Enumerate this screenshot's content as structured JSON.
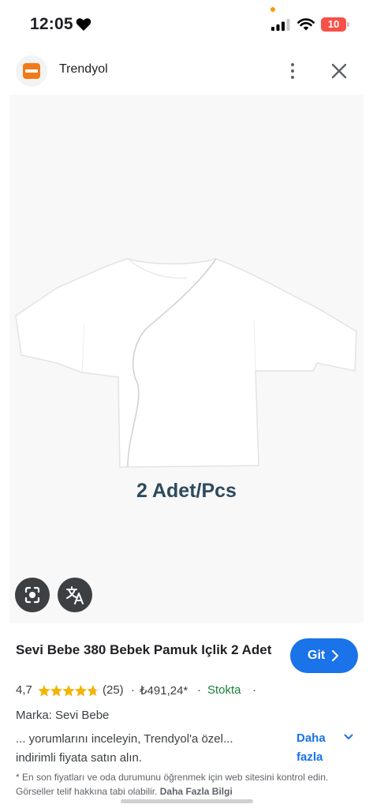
{
  "status_bar": {
    "time": "12:05",
    "battery_level": "10",
    "battery_fraction": 0.1,
    "battery_color": "#ff3b30",
    "icons": [
      "heart-icon",
      "signal-icon",
      "wifi-icon",
      "battery-icon"
    ]
  },
  "header": {
    "site_name": "Trendyol",
    "brand_color": "#f27a1a",
    "icons": [
      "more-vert-icon",
      "close-icon"
    ]
  },
  "image": {
    "overlay_text": "2 Adet/Pcs",
    "icons": [
      "lens-icon",
      "translate-icon"
    ]
  },
  "product": {
    "title": "Sevi Bebe 380 Bebek Pamuk Içlik 2 Adet",
    "go_label": "Git",
    "rating": "4,7",
    "rating_count": "(25)",
    "stars": 4.7,
    "separator": "·",
    "price": "₺491,24*",
    "stock": "Stokta",
    "brand": "Marka: Sevi Bebe",
    "snippet": "... yorumlarını inceleyin, Trendyol'a özel... indirimli fiyata satın alın.",
    "more_label": "Daha fazla",
    "accent_color": "#1a73e8",
    "stock_color": "#188038"
  },
  "footer": {
    "disclaimer": "* En son fiyatları ve oda durumunu öğrenmek için web sitesini kontrol edin. Görseller telif hakkına tabi olabilir.",
    "more_info": "Daha Fazla Bilgi"
  }
}
